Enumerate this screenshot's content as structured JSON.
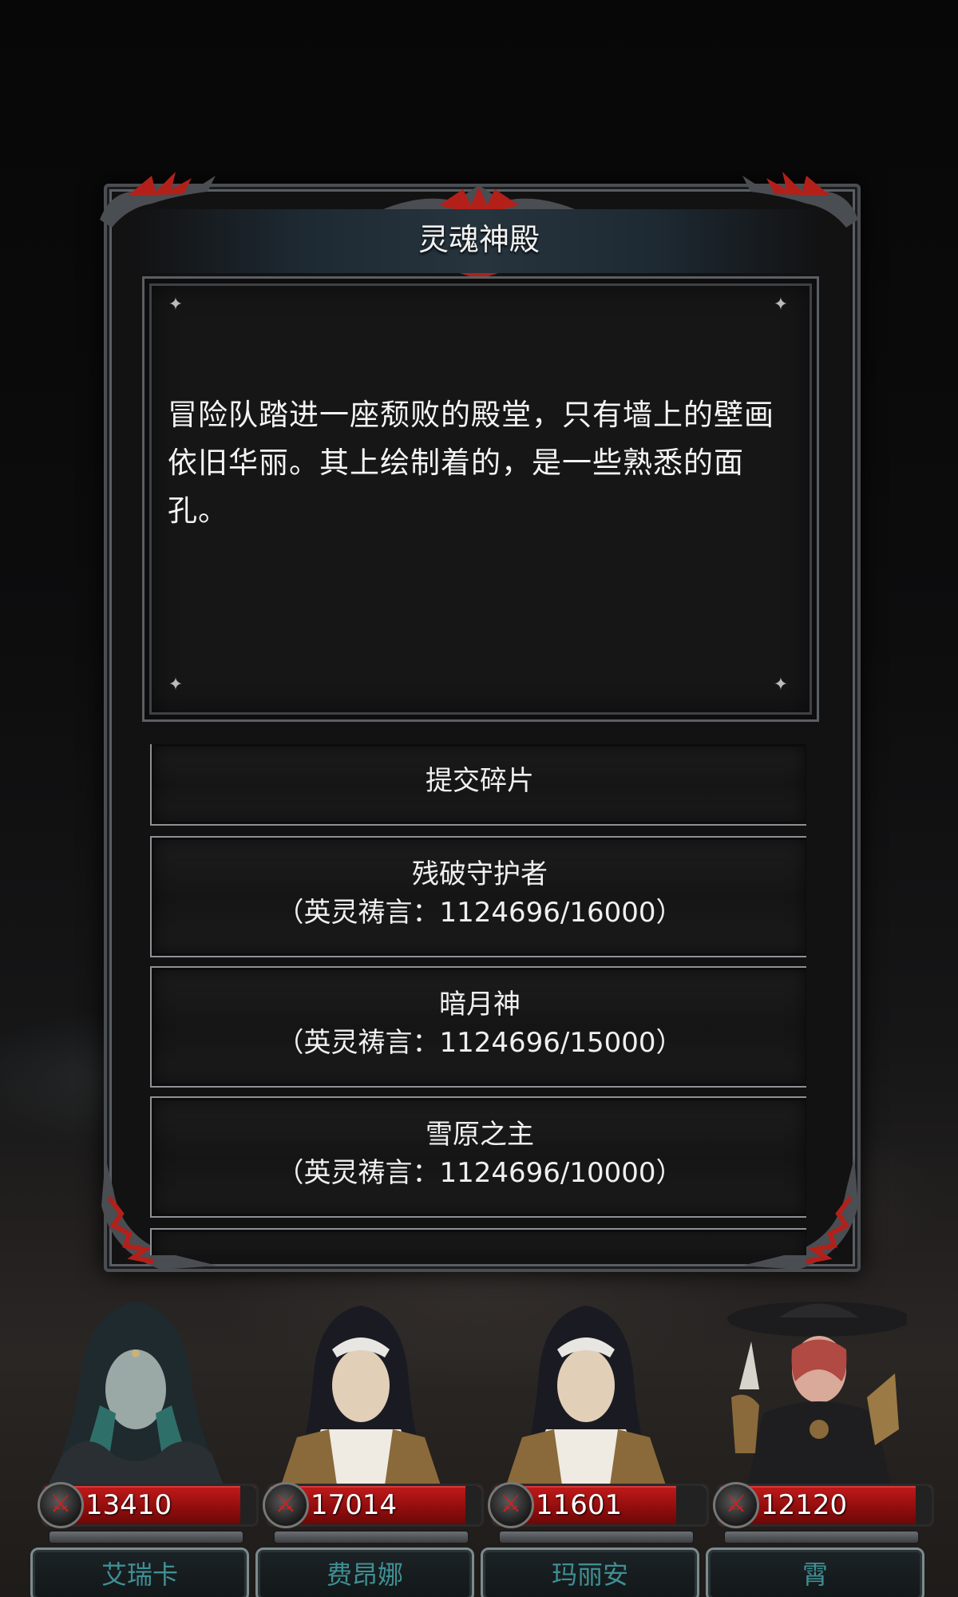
{
  "dialog": {
    "title": "灵魂神殿",
    "description": "冒险队踏进一座颓败的殿堂，只有墙上的壁画依旧华丽。其上绘制着的，是一些熟悉的面孔。"
  },
  "options": [
    {
      "name": "提交碎片",
      "cost": ""
    },
    {
      "name": "残破守护者",
      "cost": "（英灵祷言：1124696/16000）"
    },
    {
      "name": "暗月神",
      "cost": "（英灵祷言：1124696/15000）"
    },
    {
      "name": "雪原之主",
      "cost": "（英灵祷言：1124696/10000）"
    }
  ],
  "party": [
    {
      "name": "艾瑞卡",
      "hp": "13410",
      "hp_fraction": 0.92
    },
    {
      "name": "费昂娜",
      "hp": "17014",
      "hp_fraction": 0.92
    },
    {
      "name": "玛丽安",
      "hp": "11601",
      "hp_fraction": 0.75
    },
    {
      "name": "霄",
      "hp": "12120",
      "hp_fraction": 0.92
    }
  ],
  "colors": {
    "hp_red": "#c11a1a",
    "name_teal": "#3f8f94",
    "frame_steel": "#5a5e63",
    "ornament_red": "#b3201a"
  }
}
